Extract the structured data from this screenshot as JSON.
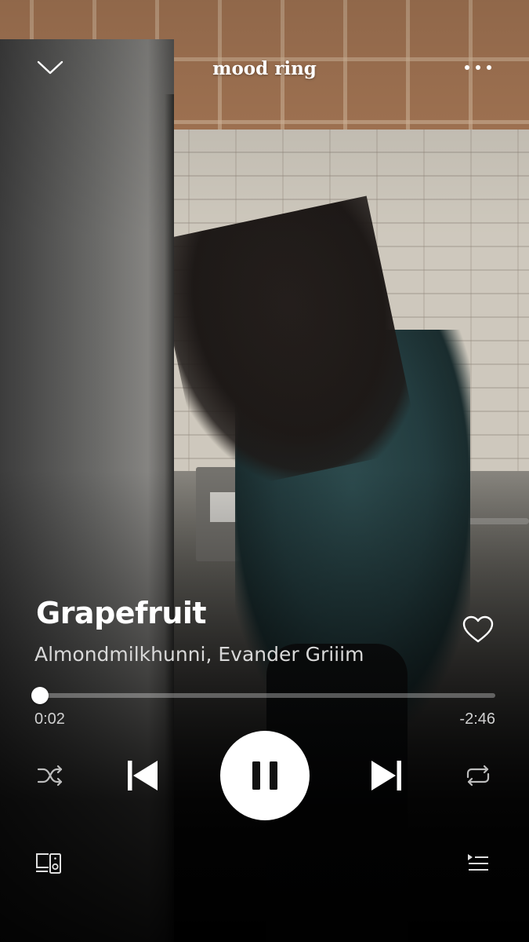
{
  "header": {
    "title": "mood ring",
    "collapse_icon": "chevron-down-icon",
    "more_icon": "more-horizontal-icon"
  },
  "track": {
    "title": "Grapefruit",
    "artists": "Almondmilkhunni, Evander Griiim",
    "liked": false
  },
  "playback": {
    "elapsed": "0:02",
    "remaining": "-2:46",
    "progress_fraction": 0.012,
    "is_playing": true
  },
  "controls": {
    "shuffle_icon": "shuffle-icon",
    "previous_icon": "skip-previous-icon",
    "pause_icon": "pause-icon",
    "next_icon": "skip-next-icon",
    "repeat_icon": "repeat-icon"
  },
  "footer": {
    "devices_icon": "devices-icon",
    "queue_icon": "queue-icon"
  },
  "colors": {
    "text_primary": "#ffffff",
    "text_secondary": "#d8d8d8",
    "progress_track": "rgba(255,255,255,0.32)"
  }
}
